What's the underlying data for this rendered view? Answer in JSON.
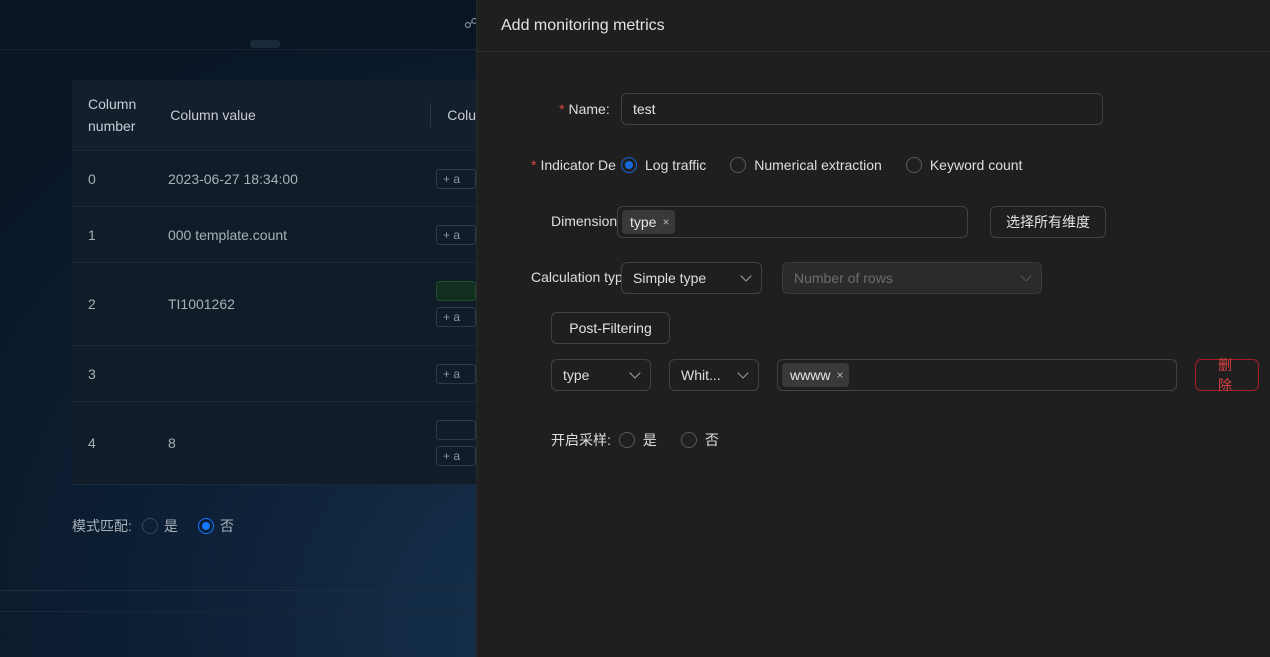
{
  "background": {
    "table": {
      "headers": {
        "column_number": "Column number",
        "column_value": "Column value",
        "column_third": "Colu"
      },
      "rows": [
        {
          "num": "0",
          "value": "2023-06-27 18:34:00",
          "tag": "+ a"
        },
        {
          "num": "1",
          "value": "000 template.count",
          "tag": "+ a"
        },
        {
          "num": "2",
          "value": "TI1001262",
          "tag": "+ a"
        },
        {
          "num": "3",
          "value": "",
          "tag": "+ a"
        },
        {
          "num": "4",
          "value": "8",
          "tag": "+ a"
        }
      ]
    },
    "pattern_match": {
      "label": "模式匹配:",
      "yes": "是",
      "no": "否",
      "selected": "否"
    }
  },
  "drawer": {
    "title": "Add monitoring metrics",
    "name": {
      "label": "Name",
      "value": "test"
    },
    "indicator": {
      "label": "Indicator De",
      "options": [
        "Log traffic",
        "Numerical extraction",
        "Keyword count"
      ],
      "selected": "Log traffic"
    },
    "dimension": {
      "label": "Dimension",
      "tags": [
        "type"
      ],
      "select_all_button": "选择所有维度"
    },
    "calculation": {
      "label": "Calculation typ",
      "type_value": "Simple type",
      "metric_placeholder": "Number of rows"
    },
    "post_filtering": {
      "button": "Post-Filtering",
      "field_value": "type",
      "operator_value": "Whit...",
      "values": [
        "wwww"
      ],
      "delete_button": "删除"
    },
    "sampling": {
      "label": "开启采样:",
      "yes": "是",
      "no": "否"
    }
  }
}
